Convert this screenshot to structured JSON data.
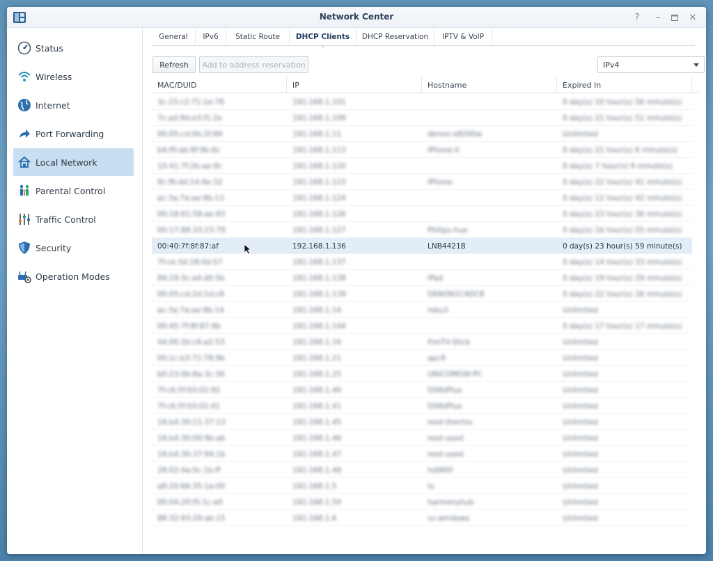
{
  "window": {
    "title": "Network Center"
  },
  "sidebar": {
    "items": [
      {
        "label": "Status",
        "icon": "gauge-icon"
      },
      {
        "label": "Wireless",
        "icon": "wifi-icon"
      },
      {
        "label": "Internet",
        "icon": "globe-icon"
      },
      {
        "label": "Port Forwarding",
        "icon": "forward-arrow-icon"
      },
      {
        "label": "Local Network",
        "icon": "home-network-icon",
        "active": true
      },
      {
        "label": "Parental Control",
        "icon": "family-icon"
      },
      {
        "label": "Traffic Control",
        "icon": "sliders-icon"
      },
      {
        "label": "Security",
        "icon": "shield-icon"
      },
      {
        "label": "Operation Modes",
        "icon": "router-gear-icon"
      }
    ]
  },
  "tabs": [
    "General",
    "IPv6",
    "Static Route",
    "DHCP Clients",
    "DHCP Reservation",
    "IPTV & VoIP"
  ],
  "active_tab": "DHCP Clients",
  "toolbar": {
    "refresh_label": "Refresh",
    "add_label": "Add to address reservation",
    "protocol_value": "IPv4"
  },
  "table": {
    "columns": [
      "MAC/DUID",
      "IP",
      "Hostname",
      "Expired In"
    ],
    "rows": [
      [
        "3c:15:c2:71:1e:78",
        "192.168.1.101",
        "",
        "0 day(s) 10 hour(s) 56 minute(s)"
      ],
      [
        "7c:ad:9d:e3:f1:2e",
        "192.168.1.109",
        "",
        "0 day(s) 21 hour(s) 51 minute(s)"
      ],
      [
        "00:05:cd:0b:2f:84",
        "192.168.1.11",
        "denon-x8200w",
        "Unlimited"
      ],
      [
        "b4:f0:ab:9f:9b:6c",
        "192.168.1.113",
        "iPhone-X",
        "0 day(s) 21 hour(s) 6 minute(s)"
      ],
      [
        "10:41:7f:2b:ae:9c",
        "192.168.1.120",
        "",
        "0 day(s) 7 hour(s) 9 minute(s)"
      ],
      [
        "9c:f6:dd:14:4e:32",
        "192.168.1.123",
        "iPhone",
        "0 day(s) 22 hour(s) 41 minute(s)"
      ],
      [
        "ac:3a:7a:ae:9b:13",
        "192.168.1.124",
        "",
        "0 day(s) 12 hour(s) 42 minute(s)"
      ],
      [
        "00:18:61:58:ae:93",
        "192.168.1.126",
        "",
        "0 day(s) 23 hour(s) 36 minute(s)"
      ],
      [
        "00:17:88:33:23:79",
        "192.168.1.127",
        "Philips-hue",
        "0 day(s) 16 hour(s) 55 minute(s)"
      ],
      [
        "00:40:7f:8f:87:af",
        "192.168.1.136",
        "LNB4421B",
        "0 day(s) 23 hour(s) 59 minute(s)"
      ],
      [
        "7f:ce:3d:18:0d:57",
        "192.168.1.137",
        "",
        "0 day(s) 14 hour(s) 33 minute(s)"
      ],
      [
        "84:29:3c:a4:d0:5b",
        "192.168.1.138",
        "iPad",
        "0 day(s) 19 hour(s) 29 minute(s)"
      ],
      [
        "00:05:cd:2d:1d:c8",
        "192.168.1.139",
        "DENON1C4DC8",
        "0 day(s) 22 hour(s) 26 minute(s)"
      ],
      [
        "ac:3a:7a:ae:9b:14",
        "192.168.1.14",
        "roku3",
        "Unlimited"
      ],
      [
        "00:45:7f:8f:87:9b",
        "192.168.1.144",
        "",
        "0 day(s) 17 hour(s) 17 minute(s)"
      ],
      [
        "44:00:2b:c6:a2:53",
        "192.168.1.16",
        "FireTV-Stick",
        "Unlimited"
      ],
      [
        "00:1c:b3:71:78:9b",
        "192.168.1.21",
        "apc9",
        "Unlimited"
      ],
      [
        "b0:23:0b:8a:3c:36",
        "192.168.1.25",
        "UNICOMGW-PC",
        "Unlimited"
      ],
      [
        "7f:c6:5f:03:02:92",
        "192.168.1.40",
        "DS8dPlus",
        "Unlimited"
      ],
      [
        "7f:c6:5f:03:02:41",
        "192.168.1.41",
        "DS8dPlus",
        "Unlimited"
      ],
      [
        "18:b4:30:11:37:13",
        "192.168.1.45",
        "nest-thermo",
        "Unlimited"
      ],
      [
        "18:b4:30:00:9b:ab",
        "192.168.1.46",
        "nest-seed",
        "Unlimited"
      ],
      [
        "18:b4:30:37:94:1b",
        "192.168.1.47",
        "nest-seed",
        "Unlimited"
      ],
      [
        "28:02:4a:0c:1b:ff",
        "192.168.1.48",
        "hdl800",
        "Unlimited"
      ],
      [
        "a8:20:66:35:1a:00",
        "192.168.1.5",
        "ts",
        "Unlimited"
      ],
      [
        "00:04:20:f5:1c:e0",
        "192.168.1.50",
        "harmonyhub",
        "Unlimited"
      ],
      [
        "88:32:93:29:ab:15",
        "192.168.1.6",
        "sv-windows",
        "Unlimited"
      ]
    ],
    "selected_row_index": 9
  }
}
